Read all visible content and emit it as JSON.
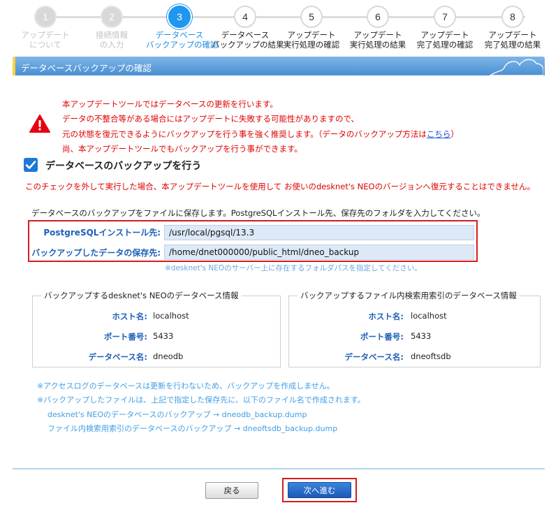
{
  "stepper": {
    "steps": [
      {
        "num": "1",
        "line1": "アップデート",
        "line2": "について",
        "state": "done"
      },
      {
        "num": "2",
        "line1": "接続情報",
        "line2": "の入力",
        "state": "done"
      },
      {
        "num": "3",
        "line1": "データベース",
        "line2": "バックアップの確認",
        "state": "active"
      },
      {
        "num": "4",
        "line1": "データベース",
        "line2": "バックアップの結果",
        "state": "todo"
      },
      {
        "num": "5",
        "line1": "アップデート",
        "line2": "実行処理の確認",
        "state": "todo"
      },
      {
        "num": "6",
        "line1": "アップデート",
        "line2": "実行処理の結果",
        "state": "todo"
      },
      {
        "num": "7",
        "line1": "アップデート",
        "line2": "完了処理の確認",
        "state": "todo"
      },
      {
        "num": "8",
        "line1": "アップデート",
        "line2": "完了処理の結果",
        "state": "todo"
      }
    ]
  },
  "section_title": "データベースバックアップの確認",
  "warning": {
    "line1": "本アップデートツールではデータベースの更新を行います。",
    "line2": "データの不整合等がある場合にはアップデートに失敗する可能性がありますので、",
    "line3_pre": "元の状態を復元できるようにバックアップを行う事を強く推奨します。（データのバックアップ方法は",
    "line3_link": "こちら",
    "line3_post": "）",
    "line4": "尚、本アップデートツールでもバックアップを行う事ができます。"
  },
  "backup_checkbox": {
    "label": "データベースのバックアップを行う",
    "checked": true
  },
  "backup_note": "このチェックを外して実行した場合、本アップデートツールを使用して お使いのdesknet's NEOのバージョンへ復元することはできません。",
  "description": "データベースのバックアップをファイルに保存します。PostgreSQLインストール先、保存先のフォルダを入力してください。",
  "fields": {
    "install_label": "PostgreSQLインストール先:",
    "install_value": "/usr/local/pgsql/13.3",
    "save_label": "バックアップしたデータの保存先:",
    "save_value": "/home/dnet000000/public_html/dneo_backup",
    "hint": "※desknet's NEOのサーバー上に存在するフォルダパスを指定してください。"
  },
  "db_info": {
    "legend": "バックアップするdesknet's NEOのデータベース情報",
    "host_label": "ホスト名:",
    "host": "localhost",
    "port_label": "ポート番号:",
    "port": "5433",
    "db_label": "データベース名:",
    "db": "dneodb"
  },
  "fts_info": {
    "legend": "バックアップするファイル内検索用索引のデータベース情報",
    "host_label": "ホスト名:",
    "host": "localhost",
    "port_label": "ポート番号:",
    "port": "5433",
    "db_label": "データベース名:",
    "db": "dneoftsdb"
  },
  "notes": {
    "n1": "※アクセスログのデータベースは更新を行わないため、バックアップを作成しません。",
    "n2": "※バックアップしたファイルは、上記で指定した保存先に、以下のファイル名で作成されます。",
    "n3": "desknet's NEOのデータベースのバックアップ → dneodb_backup.dump",
    "n4": "ファイル内検索用索引のデータベースのバックアップ → dneoftsdb_backup.dump"
  },
  "buttons": {
    "back": "戻る",
    "next": "次へ進む"
  },
  "colors": {
    "accent": "#1f97ef",
    "warning": "#e00000",
    "label_blue": "#1d5fb8",
    "highlight_frame": "#d81b1b"
  }
}
